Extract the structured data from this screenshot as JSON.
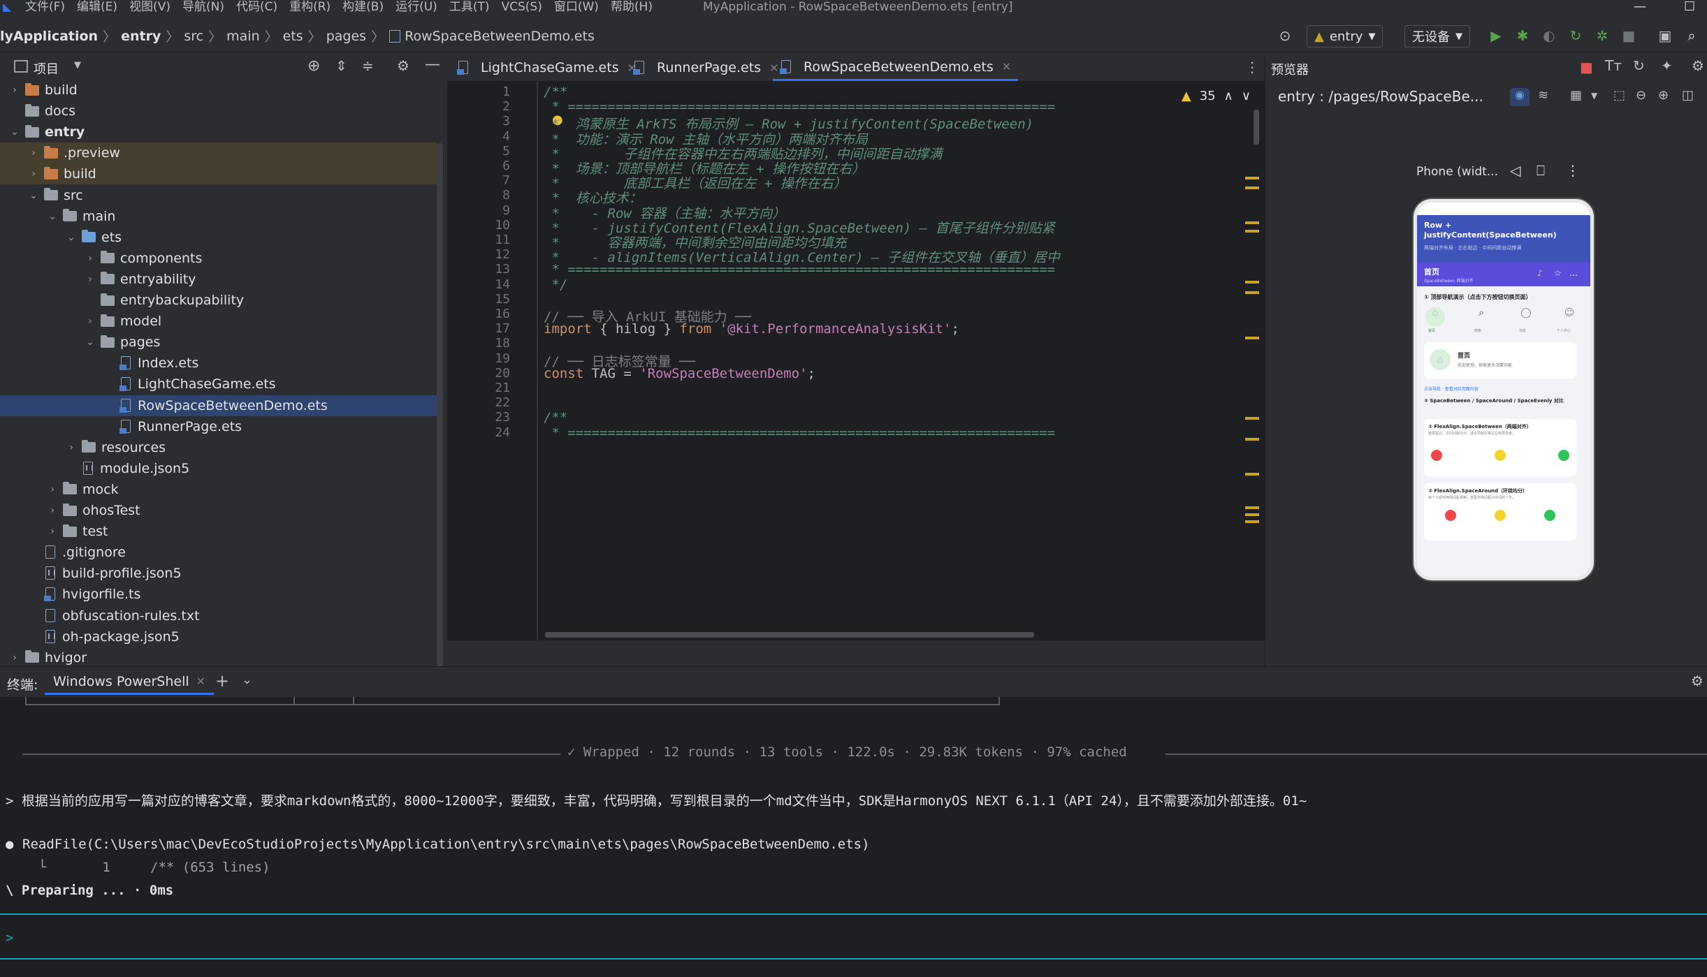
{
  "menubar": {
    "items": [
      "文件(F)",
      "编辑(E)",
      "视图(V)",
      "导航(N)",
      "代码(C)",
      "重构(R)",
      "构建(B)",
      "运行(U)",
      "工具(T)",
      "VCS(S)",
      "窗口(W)",
      "帮助(H)"
    ],
    "window_title": "MyApplication - RowSpaceBetweenDemo.ets [entry]",
    "minimize": "—",
    "maximize": "☐"
  },
  "breadcrumb": {
    "project": "lyApplication",
    "parts": [
      "entry",
      "src",
      "main",
      "ets",
      "pages"
    ],
    "file": "RowSpaceBetweenDemo.ets"
  },
  "toolbar": {
    "run_config": "entry",
    "device": "无设备"
  },
  "project_panel": {
    "title": "项目"
  },
  "tree": [
    {
      "label": "build",
      "depth": 1,
      "arrow": "›",
      "icon": "folder-orange"
    },
    {
      "label": "docs",
      "depth": 1,
      "arrow": "",
      "icon": "folder"
    },
    {
      "label": "entry",
      "depth": 1,
      "arrow": "⌄",
      "icon": "folder-module",
      "bold": true
    },
    {
      "label": ".preview",
      "depth": 2,
      "arrow": "›",
      "icon": "folder-orange",
      "hl": true
    },
    {
      "label": "build",
      "depth": 2,
      "arrow": "›",
      "icon": "folder-orange",
      "hl": true
    },
    {
      "label": "src",
      "depth": 2,
      "arrow": "⌄",
      "icon": "folder"
    },
    {
      "label": "main",
      "depth": 3,
      "arrow": "⌄",
      "icon": "folder"
    },
    {
      "label": "ets",
      "depth": 4,
      "arrow": "⌄",
      "icon": "folder-blue"
    },
    {
      "label": "components",
      "depth": 5,
      "arrow": "›",
      "icon": "folder"
    },
    {
      "label": "entryability",
      "depth": 5,
      "arrow": "›",
      "icon": "folder"
    },
    {
      "label": "entrybackupability",
      "depth": 5,
      "arrow": "",
      "icon": "folder"
    },
    {
      "label": "model",
      "depth": 5,
      "arrow": "›",
      "icon": "folder"
    },
    {
      "label": "pages",
      "depth": 5,
      "arrow": "⌄",
      "icon": "folder"
    },
    {
      "label": "Index.ets",
      "depth": 6,
      "arrow": "",
      "icon": "file-ets"
    },
    {
      "label": "LightChaseGame.ets",
      "depth": 6,
      "arrow": "",
      "icon": "file-ets"
    },
    {
      "label": "RowSpaceBetweenDemo.ets",
      "depth": 6,
      "arrow": "",
      "icon": "file-ets",
      "selected": true
    },
    {
      "label": "RunnerPage.ets",
      "depth": 6,
      "arrow": "",
      "icon": "file-ets"
    },
    {
      "label": "resources",
      "depth": 4,
      "arrow": "›",
      "icon": "folder"
    },
    {
      "label": "module.json5",
      "depth": 4,
      "arrow": "",
      "icon": "file-json"
    },
    {
      "label": "mock",
      "depth": 3,
      "arrow": "›",
      "icon": "folder"
    },
    {
      "label": "ohosTest",
      "depth": 3,
      "arrow": "›",
      "icon": "folder"
    },
    {
      "label": "test",
      "depth": 3,
      "arrow": "›",
      "icon": "folder"
    },
    {
      "label": ".gitignore",
      "depth": 2,
      "arrow": "",
      "icon": "file"
    },
    {
      "label": "build-profile.json5",
      "depth": 2,
      "arrow": "",
      "icon": "file-json"
    },
    {
      "label": "hvigorfile.ts",
      "depth": 2,
      "arrow": "",
      "icon": "file-ets"
    },
    {
      "label": "obfuscation-rules.txt",
      "depth": 2,
      "arrow": "",
      "icon": "file"
    },
    {
      "label": "oh-package.json5",
      "depth": 2,
      "arrow": "",
      "icon": "file-json"
    },
    {
      "label": "hvigor",
      "depth": 1,
      "arrow": "›",
      "icon": "folder"
    }
  ],
  "tabs": [
    {
      "label": "LightChaseGame.ets",
      "active": false
    },
    {
      "label": "RunnerPage.ets",
      "active": false
    },
    {
      "label": "RowSpaceBetweenDemo.ets",
      "active": true
    }
  ],
  "editor": {
    "warnings": "35",
    "lines": [
      {
        "n": "1",
        "segs": [
          [
            "cmt",
            "/**"
          ]
        ]
      },
      {
        "n": "2",
        "segs": [
          [
            "cmt",
            " * ============================================================="
          ]
        ]
      },
      {
        "n": "3",
        "segs": [
          [
            "cmt",
            " *  鸿蒙原生 ArkTS 布局示例 — Row + justifyContent(SpaceBetween)"
          ]
        ]
      },
      {
        "n": "4",
        "segs": [
          [
            "cmt",
            " *  功能：演示 Row 主轴（水平方向）两端对齐布局"
          ]
        ]
      },
      {
        "n": "5",
        "segs": [
          [
            "cmt",
            " *        子组件在容器中左右两端贴边排列，中间间距自动撑满"
          ]
        ]
      },
      {
        "n": "6",
        "segs": [
          [
            "cmt",
            " *  场景：顶部导航栏（标题在左 + 操作按钮在右）"
          ]
        ]
      },
      {
        "n": "7",
        "segs": [
          [
            "cmt",
            " *        底部工具栏（返回在左 + 操作在右）"
          ]
        ]
      },
      {
        "n": "8",
        "segs": [
          [
            "cmt",
            " *  核心技术："
          ]
        ]
      },
      {
        "n": "9",
        "segs": [
          [
            "cmt",
            " *    - Row 容器（主轴：水平方向）"
          ]
        ]
      },
      {
        "n": "10",
        "segs": [
          [
            "cmt",
            " *    - justifyContent(FlexAlign.SpaceBetween) — 首尾子组件分别贴紧"
          ]
        ]
      },
      {
        "n": "11",
        "segs": [
          [
            "cmt",
            " *      容器两端，中间剩余空间由间距均匀填充"
          ]
        ]
      },
      {
        "n": "12",
        "segs": [
          [
            "cmt",
            " *    - alignItems(VerticalAlign.Center) — 子组件在交叉轴（垂直）居中"
          ]
        ]
      },
      {
        "n": "13",
        "segs": [
          [
            "cmt",
            " * ============================================================="
          ]
        ]
      },
      {
        "n": "14",
        "segs": [
          [
            "cmt",
            " */"
          ]
        ]
      },
      {
        "n": "15",
        "segs": []
      },
      {
        "n": "16",
        "segs": [
          [
            "grey",
            "// ── 导入 ArkUI 基础能力 ──"
          ]
        ]
      },
      {
        "n": "17",
        "segs": [
          [
            "kw",
            "import"
          ],
          [
            "plain",
            " { hilog } "
          ],
          [
            "kw",
            "from"
          ],
          [
            "plain",
            " "
          ],
          [
            "str2",
            "'@kit.PerformanceAnalysisKit'"
          ],
          [
            "plain",
            ";"
          ]
        ]
      },
      {
        "n": "18",
        "segs": []
      },
      {
        "n": "19",
        "segs": [
          [
            "grey",
            "// ── 日志标签常量 ──"
          ]
        ]
      },
      {
        "n": "20",
        "segs": [
          [
            "kw",
            "const"
          ],
          [
            "plain",
            " TAG = "
          ],
          [
            "str2",
            "'RowSpaceBetweenDemo'"
          ],
          [
            "plain",
            ";"
          ]
        ]
      },
      {
        "n": "21",
        "segs": []
      },
      {
        "n": "22",
        "segs": []
      },
      {
        "n": "23",
        "segs": [
          [
            "cmt",
            "/**"
          ]
        ]
      },
      {
        "n": "24",
        "segs": [
          [
            "cmt",
            " * ============================================================="
          ]
        ]
      }
    ]
  },
  "preview": {
    "title": "预览器",
    "route": "entry : /pages/RowSpaceBe...",
    "device": "Phone (widt...",
    "app": {
      "header_title": "Row + justifyContent(SpaceBetween)",
      "header_sub": "两端对齐布局 · 左右贴边 · 中间间距自动撑满",
      "nav_title": "首页",
      "nav_sub": "SpaceBetween 两端对齐",
      "section1": "① 顶部导航演示（点击下方按钮切换页面）",
      "icons": [
        "首页",
        "搜索",
        "消息",
        "个人中心"
      ],
      "card_title": "首页",
      "card_sub": "欢迎使用，探索更多鸿蒙功能",
      "hint": "点击导航 · 查看对应页面内容",
      "section2": "② SpaceBetween / SpaceAround / SpaceEvenly 对比",
      "demo1_title": "① FlexAlign.SpaceBetween（两端对齐）",
      "demo1_sub": "首尾贴边，中间间距均分。适合导航栏等左右布局场景。",
      "demo2_title": "② FlexAlign.SpaceAround（环绕均分）",
      "demo2_sub": "每个子组件两侧间距相等，首尾外侧间距为中间的一半。"
    }
  },
  "terminal": {
    "label": "终端:",
    "tab": "Windows PowerShell",
    "status": "✓ Wrapped · 12 rounds · 13 tools · 122.0s · 29.83K tokens · 97% cached",
    "prompt_line": "> 根据当前的应用写一篇对应的博客文章，要求markdown格式的，8000~12000字，要细致，丰富，代码明确，写到根目录的一个md文件当中，SDK是HarmonyOS NEXT 6.1.1（API 24），且不需要添加外部连接。01~",
    "readfile": "ReadFile(C:\\Users\\mac\\DevEcoStudioProjects\\MyApplication\\entry\\src\\main\\ets\\pages\\RowSpaceBetweenDemo.ets)",
    "readfile_sub": "  └       1     /** (653 lines)",
    "preparing": "\\ Preparing ... · 0ms",
    "input_prompt": ">"
  },
  "colors": {
    "accent": "#3574f0",
    "app_purple": "#5b4cdb",
    "dot_red": "#f0494a",
    "dot_yellow": "#f2d22c",
    "dot_green": "#2fc35a"
  }
}
